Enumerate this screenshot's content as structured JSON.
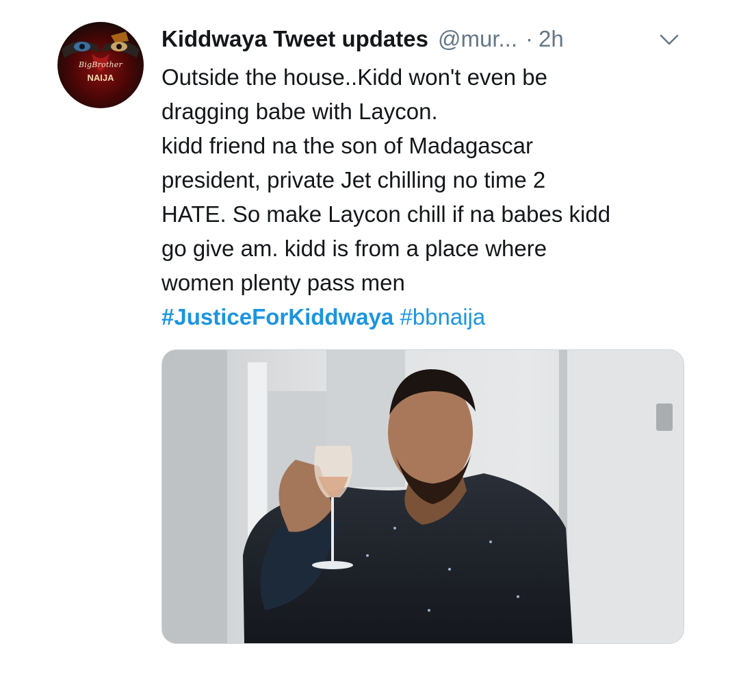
{
  "author": {
    "display_name": "Kiddwaya Tweet updates",
    "handle": "@mur...",
    "separator": "·",
    "timestamp": "2h",
    "avatar_text_line1": "BigBrother",
    "avatar_text_line2": "NAIJA"
  },
  "tweet": {
    "lines": [
      "Outside the house..Kidd won't even be",
      "dragging babe with Laycon.",
      "kidd friend na the son of Madagascar",
      "president, private Jet chilling no time 2",
      "HATE. So make Laycon chill if na babes kidd",
      "go give am. kidd is from a place where",
      "women plenty pass men"
    ],
    "hashtags": [
      "#JusticeForKiddwaya",
      "#bbnaija"
    ]
  },
  "icons": {
    "menu": "chevron-down-icon"
  },
  "colors": {
    "text_primary": "#14171a",
    "text_secondary": "#657786",
    "link": "#1b95e0",
    "media_border": "#ccd6dd"
  }
}
